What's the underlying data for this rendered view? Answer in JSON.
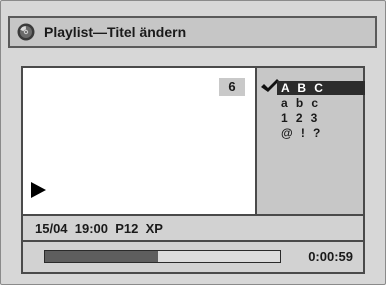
{
  "header": {
    "title": "Playlist—Titel ändern",
    "icon": "disc-icon"
  },
  "video": {
    "title_number": "6",
    "play_icon": "play-icon"
  },
  "char_set": {
    "check_icon": "checkmark-icon",
    "rows": [
      {
        "label": "A  B  C",
        "selected": true
      },
      {
        "label": "a  b  c",
        "selected": false
      },
      {
        "label": "1  2  3",
        "selected": false
      },
      {
        "label": "@  !  ?",
        "selected": false
      }
    ]
  },
  "info": {
    "text": "15/04  19:00  P12  XP"
  },
  "progress": {
    "fraction": 0.48,
    "time": "0:00:59"
  },
  "colors": {
    "background": "#d7d7d7",
    "selected_row": "#2c2c2c",
    "progress_fill": "#5e5e5e"
  }
}
